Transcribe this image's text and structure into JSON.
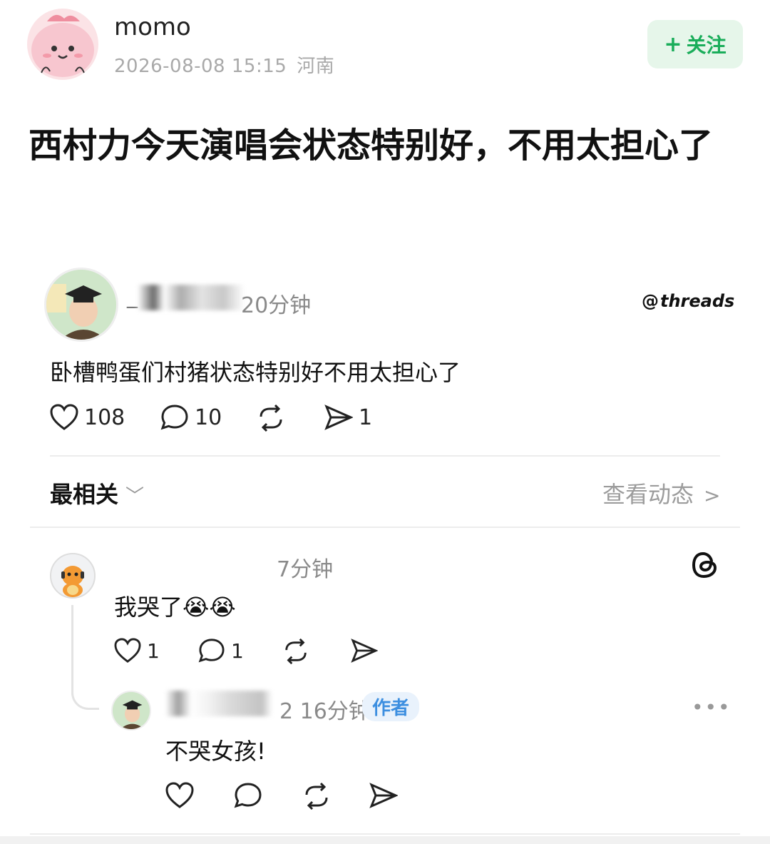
{
  "post": {
    "username": "momo",
    "date": "2026-08-08 15:15",
    "location": "河南",
    "follow_label": "关注",
    "title": "西村力今天演唱会状态特别好，不用太担心了"
  },
  "thread": {
    "user_visible": "_",
    "time": "20分钟",
    "brand": "threads",
    "text": "卧槽鸭蛋们村猪状态特别好不用太担心了",
    "likes": "108",
    "comments": "10",
    "shares": "1"
  },
  "sort": {
    "label": "最相关",
    "view_activity": "查看动态"
  },
  "comment1": {
    "time": "7分钟",
    "text": "我哭了😭😭",
    "likes": "1",
    "comments": "1"
  },
  "comment2": {
    "time": "2 16分钟",
    "badge": "作者",
    "text": "不哭女孩!"
  },
  "colors": {
    "follow_bg": "#e6f6ea",
    "follow_text": "#1aad5a",
    "author_badge_bg": "#e9f2fc",
    "author_badge_text": "#3d8fe0"
  }
}
